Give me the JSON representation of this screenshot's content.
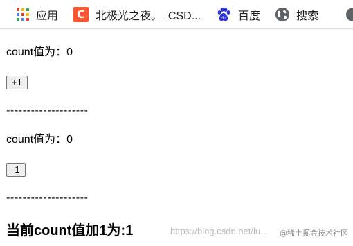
{
  "bookmarks": [
    {
      "label": "应用",
      "icon": "apps-grid-icon"
    },
    {
      "label": "北极光之夜。_CSD...",
      "icon": "csdn-icon",
      "icon_text": "C"
    },
    {
      "label": "百度",
      "icon": "baidu-paw-icon"
    },
    {
      "label": "搜索",
      "icon": "globe-icon"
    }
  ],
  "colors": {
    "csdn_brand": "#fc5531",
    "baidu_blue": "#2932e1",
    "apps_colors": [
      "#ea4335",
      "#fbbc05",
      "#34a853",
      "#4285f4",
      "#ea4335",
      "#fbbc05",
      "#34a853",
      "#4285f4",
      "#ea4335"
    ]
  },
  "section1": {
    "count_text": "count值为：0",
    "button_label": "+1",
    "separator": "--------------------"
  },
  "section2": {
    "count_text": "count值为：0",
    "button_label": "-1",
    "separator": "--------------------"
  },
  "result_text": "当前count值加1为:1",
  "watermark": "https://blog.csdn.net/lu...",
  "watermark2": "@稀土掘金技术社区"
}
